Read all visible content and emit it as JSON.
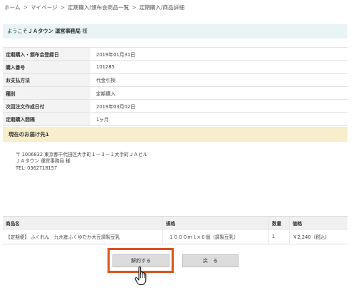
{
  "breadcrumb": [
    "ホーム",
    "マイページ",
    "定期購入/頒布会商品一覧",
    "定期購入/商品詳細"
  ],
  "welcome": {
    "prefix": "ようこそ",
    "name": "ＪＡタウン 運営事務局",
    "suffix": "様"
  },
  "info_rows": [
    {
      "label": "定期購入・頒布会登録日",
      "value": "2019年01月31日"
    },
    {
      "label": "購入番号",
      "value": "101285"
    },
    {
      "label": "お支払方法",
      "value": "代金引換"
    },
    {
      "label": "種別",
      "value": "定期購入"
    },
    {
      "label": "次回注文作成日付",
      "value": "2019年03月02日"
    },
    {
      "label": "定期購入間隔",
      "value": "1ヶ月"
    }
  ],
  "shipping": {
    "title": "現在のお届け先1",
    "address_line": "〒 1006832 東京都千代田区大手町１－３－１大手町ＪＡビル",
    "recipient": "ＪＡタウン 運営事務局 様",
    "tel": "TEL: 0362718157"
  },
  "items": {
    "headers": [
      "商品名",
      "規格",
      "数量",
      "価格"
    ],
    "rows": [
      {
        "name": "【定期便】 ふくれん　九州産ふくゆたか大豆調製豆乳",
        "spec": "１０００ｍｌ×６個（調製豆乳）",
        "qty": "1",
        "price": "￥2,240（税込）"
      }
    ]
  },
  "buttons": {
    "cancel": "解約する",
    "back": "戻　る"
  },
  "colors": {
    "highlight": "#d9531e",
    "welcome_bg": "#eaf4f4",
    "shipping_bg": "#f8eecc"
  }
}
